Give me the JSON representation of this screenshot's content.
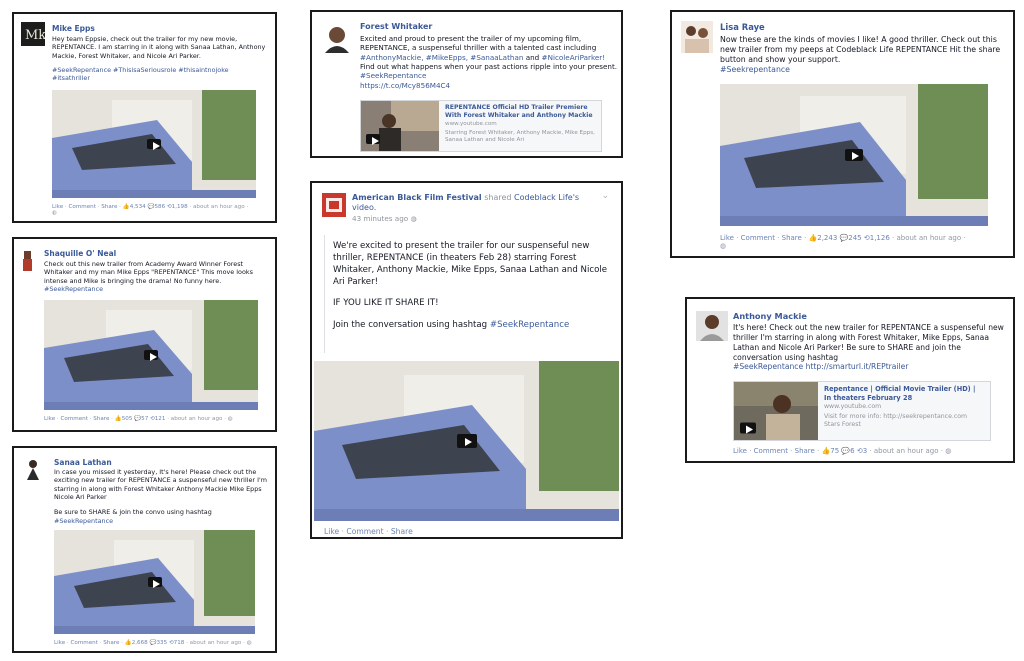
{
  "posts": {
    "mike": {
      "name": "Mike Epps",
      "text": "Hey team Eppsie, check out the trailer for my new movie, REPENTANCE. I am starring in it along with Sanaa Lathan, Anthony Mackie, Forest Whitaker, and Nicole Ari Parker.",
      "tags": "#SeekRepentance #ThisisaSeriousrole #thisaintnojoke #itsathriller",
      "like": "Like",
      "comment": "Comment",
      "share": "Share",
      "likes": "4,534",
      "comments": "586",
      "shares": "1,198",
      "time": "about an hour ago"
    },
    "shaquille": {
      "name": "Shaquille O' Neal",
      "text": "Check out this new trailer from Academy Award Winner Forest Whitaker and my man Mike Epps \"REPENTANCE\" This move looks intense and Mike is bringing the drama! No funny here.",
      "tags": "#SeekRepentance",
      "like": "Like",
      "comment": "Comment",
      "share": "Share",
      "likes": "505",
      "comments": "57",
      "shares": "121",
      "time": "about an hour ago"
    },
    "sanaa": {
      "name": "Sanaa Lathan",
      "text": "In case you missed it yesterday, It's here! Please check out the exciting new trailer for REPENTANCE a suspenseful new thriller I'm starring in along with Forest Whitaker Anthony Mackie Mike Epps Nicole Ari Parker",
      "text2": "Be sure to SHARE & join the convo using hashtag",
      "tags": "#SeekRepentance",
      "like": "Like",
      "comment": "Comment",
      "share": "Share",
      "likes": "2,668",
      "comments": "335",
      "shares": "718",
      "time": "about an hour ago"
    },
    "forest": {
      "name": "Forest Whitaker",
      "text": "Excited and proud to present the trailer of my upcoming film, REPENTANCE, a suspenseful thriller with a talented cast including",
      "tags1": "#AnthonyMackie, #MikeEpps, #SanaaLathan",
      "and": "and",
      "tags2": "#NicoleAriParker!",
      "text2": "Find out what happens when your past actions ripple into your present.",
      "tags3": "#SeekRepentance",
      "url": "https://t.co/Mcy856M4C4",
      "share_title": "REPENTANCE Official HD Trailer Premiere With Forest Whitaker and Anthony Mackie",
      "share_domain": "www.youtube.com",
      "share_desc": "Starring Forest Whitaker, Anthony Mackie, Mike Epps, Sanaa Lathan and Nicole Ari"
    },
    "abff": {
      "name": "American Black Film Festival",
      "shared": "shared",
      "shared_page": "Codeblack Life's",
      "shared_obj": "video.",
      "time": "43 minutes ago",
      "para1": "We're excited to present the trailer for our suspenseful new thriller, REPENTANCE (in theaters Feb 28) starring Forest Whitaker, Anthony Mackie, Mike Epps, Sanaa Lathan and Nicole Ari Parker!",
      "para2": "IF YOU LIKE IT SHARE IT!",
      "para3": "Join the conversation using hashtag",
      "para3_tag": "#SeekRepentance",
      "like": "Like",
      "comment": "Comment",
      "share": "Share"
    },
    "lisa": {
      "name": "Lisa Raye",
      "text": "Now these are the kinds of movies I like! A good thriller. Check out this new trailer from my peeps at Codeblack Life REPENTANCE Hit the share button and show your support.",
      "tags": "#Seekrepentance",
      "like": "Like",
      "comment": "Comment",
      "share": "Share",
      "likes": "2,243",
      "comments": "245",
      "shares": "1,126",
      "time": "about an hour ago"
    },
    "anthony": {
      "name": "Anthony Mackie",
      "text": "It's here! Check out the new trailer for REPENTANCE a suspenseful new thriller I'm starring in along with Forest Whitaker, Mike Epps, Sanaa Lathan and Nicole Ari Parker! Be sure to SHARE and join the conversation using hashtag",
      "tags": "#SeekRepentance",
      "url": "http://smarturl.it/REPtrailer",
      "share_title": "Repentance | Official Movie Trailer (HD) | In theaters February 28",
      "share_domain": "www.youtube.com",
      "share_desc": "Visit for more info: http://seekrepentance.com Stars Forest",
      "like": "Like",
      "comment": "Comment",
      "share": "Share",
      "likes": "75",
      "comments": "6",
      "shares": "3",
      "time": "about an hour ago"
    }
  },
  "colors": {
    "link": "#3b5998",
    "truck": "#7d8fc9",
    "frame": "#1a1a1a"
  }
}
